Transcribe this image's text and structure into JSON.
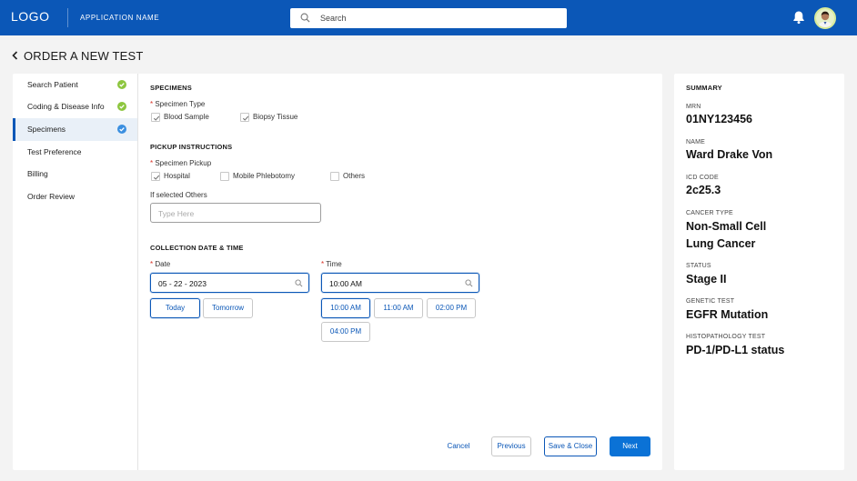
{
  "header": {
    "logo": "LOGO",
    "app_name": "APPLICATION NAME",
    "search_placeholder": "Search"
  },
  "page": {
    "title": "ORDER A NEW TEST"
  },
  "sidebar": {
    "items": [
      {
        "label": "Search Patient",
        "status": "done"
      },
      {
        "label": "Coding & Disease Info",
        "status": "done"
      },
      {
        "label": "Specimens",
        "status": "current"
      },
      {
        "label": "Test Preference",
        "status": "pending"
      },
      {
        "label": "Billing",
        "status": "pending"
      },
      {
        "label": "Order Review",
        "status": "pending"
      }
    ]
  },
  "specimens": {
    "section_title": "SPECIMENS",
    "type_label": "Specimen Type",
    "options": [
      {
        "label": "Blood Sample",
        "checked": true
      },
      {
        "label": "Biopsy Tissue",
        "checked": true
      }
    ]
  },
  "pickup": {
    "section_title": "PICKUP INSTRUCTIONS",
    "pickup_label": "Specimen Pickup",
    "options": [
      {
        "label": "Hospital",
        "checked": true
      },
      {
        "label": "Mobile Phlebotomy",
        "checked": false
      },
      {
        "label": "Others",
        "checked": false
      }
    ],
    "others_label": "If selected Others",
    "others_placeholder": "Type Here"
  },
  "collection": {
    "section_title": "COLLECTION DATE & TIME",
    "date_label": "Date",
    "date_value": "05 - 22 - 2023",
    "time_label": "Time",
    "time_value": "10:00 AM",
    "date_chips": [
      "Today",
      "Tomorrow"
    ],
    "time_chips": [
      "10:00 AM",
      "11:00 AM",
      "02:00 PM",
      "04:00 PM"
    ]
  },
  "actions": {
    "cancel": "Cancel",
    "previous": "Previous",
    "save_close": "Save & Close",
    "next": "Next"
  },
  "summary": {
    "title": "SUMMARY",
    "mrn_label": "MRN",
    "mrn": "01NY123456",
    "name_label": "NAME",
    "name": "Ward Drake Von",
    "icd_label": "ICD CODE",
    "icd": "2c25.3",
    "cancer_label": "CANCER TYPE",
    "cancer": "Non-Small Cell Lung Cancer",
    "status_label": "STATUS",
    "status": "Stage II",
    "genetic_label": "GENETIC TEST",
    "genetic": "EGFR Mutation",
    "histo_label": "HISTOPATHOLOGY TEST",
    "histo": "PD-1/PD-L1 status"
  },
  "colors": {
    "brand": "#0b57b7",
    "primary_button": "#0b72d6",
    "done_check": "#8dc63f",
    "current_check": "#3b8fe0"
  }
}
